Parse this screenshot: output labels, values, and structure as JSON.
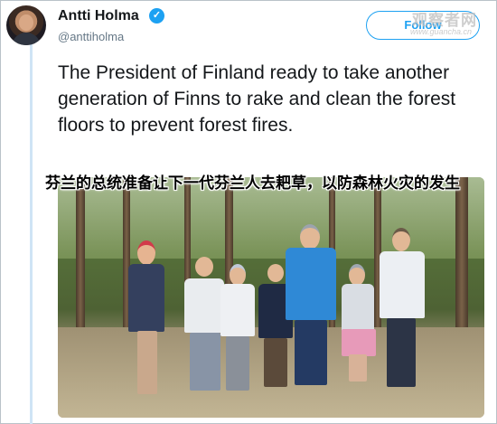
{
  "tweet": {
    "author_name": "Antti Holma",
    "handle": "@anttiholma",
    "verified_icon": "verified-badge-icon",
    "follow_label": "Follow",
    "text": "The President of Finland ready to take another generation of Finns to rake and clean the forest floors to prevent forest fires."
  },
  "overlay": {
    "caption_cn": "芬兰的总统准备让下一代芬兰人去耙草，以防森林火灾的发生",
    "watermark": "观察者网",
    "watermark_url": "www.guancha.cn"
  },
  "colors": {
    "accent": "#1da1f2",
    "thread_line": "#cfe4f5",
    "text": "#14171a",
    "muted": "#657786"
  }
}
